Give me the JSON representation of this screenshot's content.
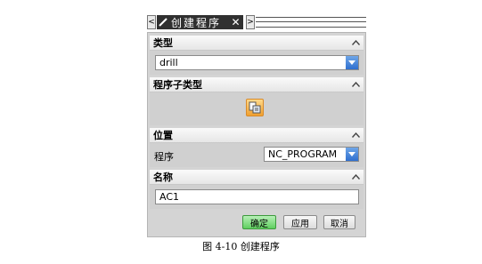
{
  "window": {
    "title": "创建程序",
    "nav_prev": "<",
    "nav_next": ">",
    "close": "✕"
  },
  "sections": {
    "type": {
      "title": "类型",
      "value": "drill"
    },
    "subtype": {
      "title": "程序子类型"
    },
    "location": {
      "title": "位置",
      "program_label": "程序",
      "program_value": "NC_PROGRAM"
    },
    "name": {
      "title": "名称",
      "value": "AC1"
    }
  },
  "buttons": {
    "ok": "确定",
    "apply": "应用",
    "cancel": "取消"
  },
  "caption": "图 4-10 创建程序",
  "icons": {
    "collapse": "chevron-up-icon",
    "dropdown": "chevron-down-icon",
    "subtype": "program-subtype-icon"
  }
}
